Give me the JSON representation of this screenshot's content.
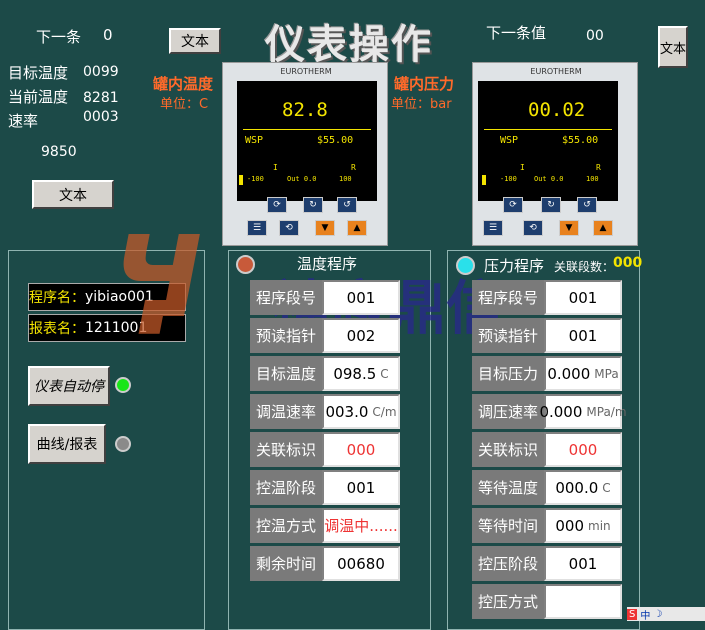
{
  "title": "仪表操作",
  "top_left": {
    "next_label": "下一条",
    "next_value": "0",
    "target_temp_label": "目标温度",
    "target_temp_value": "0099",
    "current_temp_label": "当前温度",
    "current_temp_value": "8281",
    "rate_label": "速率",
    "rate_value": "0003",
    "extra_value": "9850",
    "text_button": "文本",
    "text_button_top": "文本"
  },
  "top_right": {
    "next_label": "下一条值",
    "next_value": "00",
    "text_button": "文本"
  },
  "temp_meter": {
    "heading": "罐内温度",
    "unit": "单位：C",
    "brand": "EUROTHERM",
    "pv": "82.8",
    "wsp_label": "WSP",
    "wsp_value": "$55.00",
    "i_mark": "I",
    "r_mark": "R",
    "scale_left": "-100",
    "scale_mid": "Out 0.0",
    "scale_right": "100"
  },
  "press_meter": {
    "heading": "罐内压力",
    "unit": "单位：bar",
    "brand": "EUROTHERM",
    "pv": "00.02",
    "wsp_label": "WSP",
    "wsp_value": "$55.00",
    "i_mark": "I",
    "r_mark": "R",
    "scale_left": "-100",
    "scale_mid": "Out 0.0",
    "scale_right": "100"
  },
  "left_panel": {
    "program_name_label": "程序名：",
    "program_name_value": "yibiao001",
    "report_name_label": "报表名：",
    "report_name_value": "1211001",
    "auto_stop_button": "仪表自动停",
    "curve_report_button": "曲线/报表",
    "colors": {
      "lamp_on": "#19e619",
      "lamp_off": "#8a8a8a"
    }
  },
  "temp_program": {
    "title": "温度程序",
    "rows": [
      {
        "label": "程序段号",
        "value": "001",
        "unit": ""
      },
      {
        "label": "预读指针",
        "value": "002",
        "unit": ""
      },
      {
        "label": "目标温度",
        "value": "098.5",
        "unit": "C"
      },
      {
        "label": "调温速率",
        "value": "003.0",
        "unit": "C/m"
      },
      {
        "label": "关联标识",
        "value": "000",
        "unit": ""
      },
      {
        "label": "控温阶段",
        "value": "001",
        "unit": ""
      },
      {
        "label": "控温方式",
        "value": "调温中......",
        "unit": ""
      },
      {
        "label": "剩余时间",
        "value": "00680",
        "unit": ""
      }
    ]
  },
  "press_program": {
    "title": "压力程序",
    "linked_label": "关联段数：",
    "linked_value": "000",
    "rows": [
      {
        "label": "程序段号",
        "value": "001",
        "unit": ""
      },
      {
        "label": "预读指针",
        "value": "001",
        "unit": ""
      },
      {
        "label": "目标压力",
        "value": "0.000",
        "unit": "MPa"
      },
      {
        "label": "调压速率",
        "value": "0.000",
        "unit": "MPa/m"
      },
      {
        "label": "关联标识",
        "value": "000",
        "unit": ""
      },
      {
        "label": "等待温度",
        "value": "000.0",
        "unit": "C"
      },
      {
        "label": "等待时间",
        "value": "000",
        "unit": "min"
      },
      {
        "label": "控压阶段",
        "value": "001",
        "unit": ""
      },
      {
        "label": "控压方式",
        "value": "",
        "unit": ""
      }
    ]
  },
  "watermark": "神鹰鼎信",
  "tray": {
    "ime": "中"
  }
}
